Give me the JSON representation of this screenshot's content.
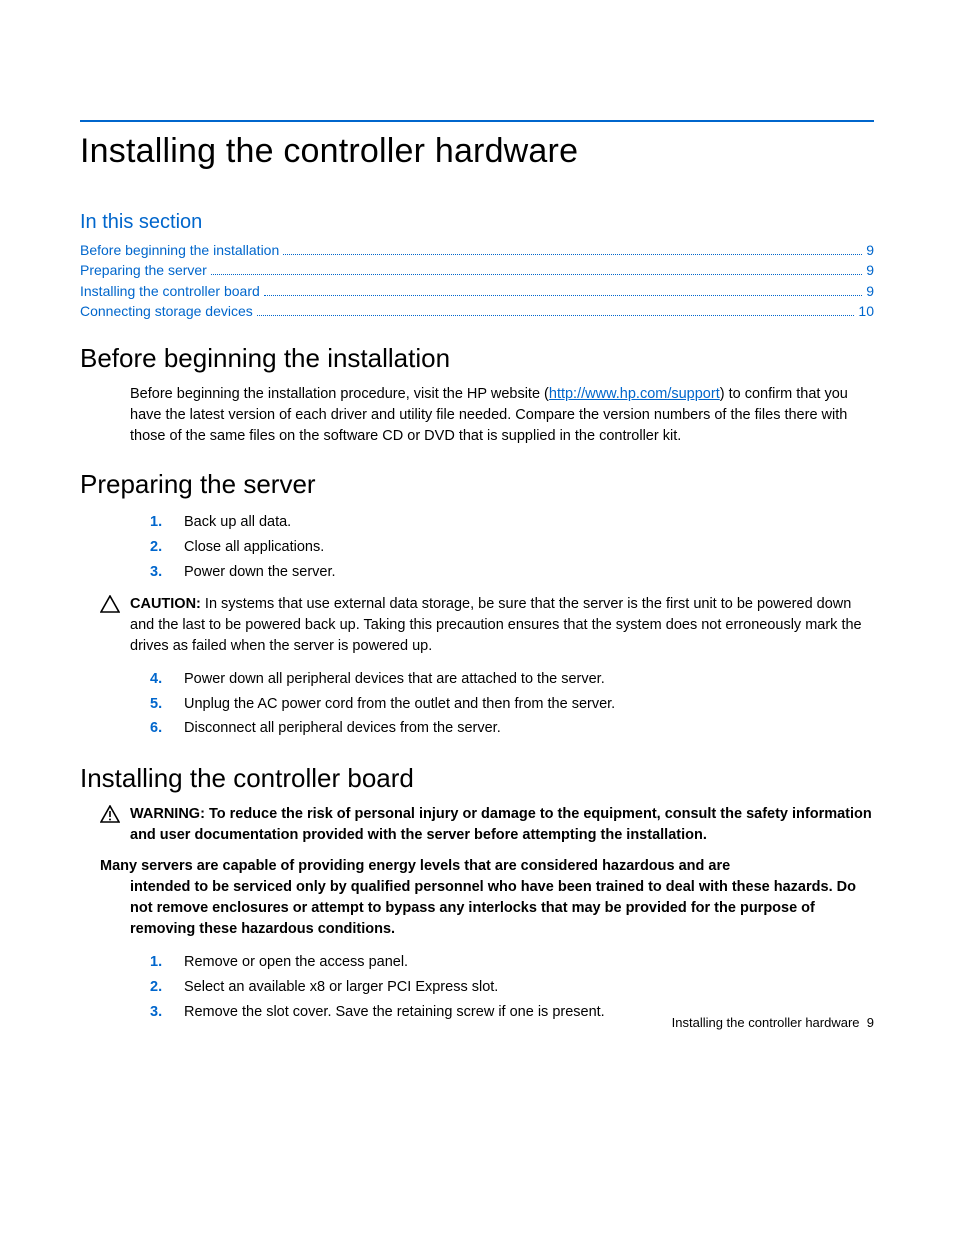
{
  "title": "Installing the controller hardware",
  "in_this_section_label": "In this section",
  "toc": [
    {
      "label": "Before beginning the installation",
      "page": "9"
    },
    {
      "label": "Preparing the server",
      "page": "9"
    },
    {
      "label": "Installing the controller board",
      "page": "9"
    },
    {
      "label": "Connecting storage devices",
      "page": "10"
    }
  ],
  "sec1": {
    "heading": "Before beginning the installation",
    "para_pre": "Before beginning the installation procedure, visit the HP website (",
    "link_text": "http://www.hp.com/support",
    "para_post": ") to confirm that you have the latest version of each driver and utility file needed. Compare the version numbers of the files there with those of the same files on the software CD or DVD that is supplied in the controller kit."
  },
  "sec2": {
    "heading": "Preparing the server",
    "steps_a": [
      "Back up all data.",
      "Close all applications.",
      "Power down the server."
    ],
    "caution_label": "CAUTION:",
    "caution_text": "  In systems that use external data storage, be sure that the server is the first unit to be powered down and the last to be powered back up. Taking this precaution ensures that the system does not erroneously mark the drives as failed when the server is powered up.",
    "steps_b": [
      "Power down all peripheral devices that are attached to the server.",
      "Unplug the AC power cord from the outlet and then from the server.",
      "Disconnect all peripheral devices from the server."
    ]
  },
  "sec3": {
    "heading": "Installing the controller board",
    "warning_label": "WARNING:",
    "warning_text": "  To reduce the risk of personal injury or damage to the equipment, consult the safety information and user documentation provided with the server before attempting the installation.",
    "bold_para_first": "Many servers are capable of providing energy levels that are considered hazardous and are",
    "bold_para_rest": "intended to be serviced only by qualified personnel who have been trained to deal with these hazards. Do not remove enclosures or attempt to bypass any interlocks that may be provided for the purpose of removing these hazardous conditions.",
    "steps": [
      "Remove or open the access panel.",
      "Select an available x8 or larger PCI Express slot.",
      "Remove the slot cover. Save the retaining screw if one is present."
    ]
  },
  "footer": {
    "text": "Installing the controller hardware",
    "page": "9"
  }
}
